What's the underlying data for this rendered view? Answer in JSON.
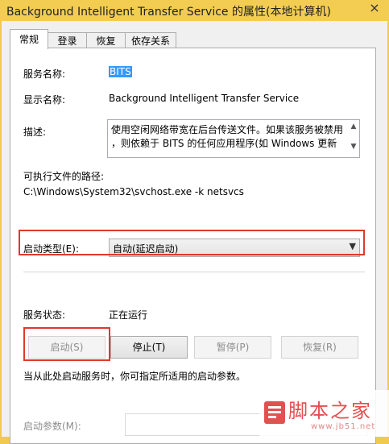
{
  "window": {
    "title": "Background Intelligent Transfer Service 的属性(本地计算机)",
    "close_glyph": "×"
  },
  "tabs": [
    {
      "label": "常规",
      "active": true
    },
    {
      "label": "登录"
    },
    {
      "label": "恢复"
    },
    {
      "label": "依存关系"
    }
  ],
  "general": {
    "service_name_label": "服务名称:",
    "service_name_value": "BITS",
    "display_name_label": "显示名称:",
    "display_name_value": "Background Intelligent Transfer Service",
    "description_label": "描述:",
    "description_lines": [
      "使用空闲网络带宽在后台传送文件。如果该服务被禁用",
      "，则依赖于 BITS 的任何应用程序(如 Windows 更新"
    ],
    "exe_path_label": "可执行文件的路径:",
    "exe_path_value": "C:\\Windows\\System32\\svchost.exe -k netsvcs",
    "startup_type_label": "启动类型(E):",
    "startup_type_value": "自动(延迟启动)",
    "status_label": "服务状态:",
    "status_value": "正在运行",
    "buttons": {
      "start": "启动(S)",
      "stop": "停止(T)",
      "pause": "暂停(P)",
      "resume": "恢复(R)"
    },
    "hint": "当从此处启动服务时，你可指定所适用的启动参数。",
    "params_label": "启动参数(M):",
    "params_value": ""
  },
  "watermark": {
    "text": "脚本之家",
    "url": "www.jb51.net"
  },
  "colors": {
    "title_bar": "#f3cd52",
    "highlight_box": "#e0392b",
    "selection": "#3399ff"
  }
}
